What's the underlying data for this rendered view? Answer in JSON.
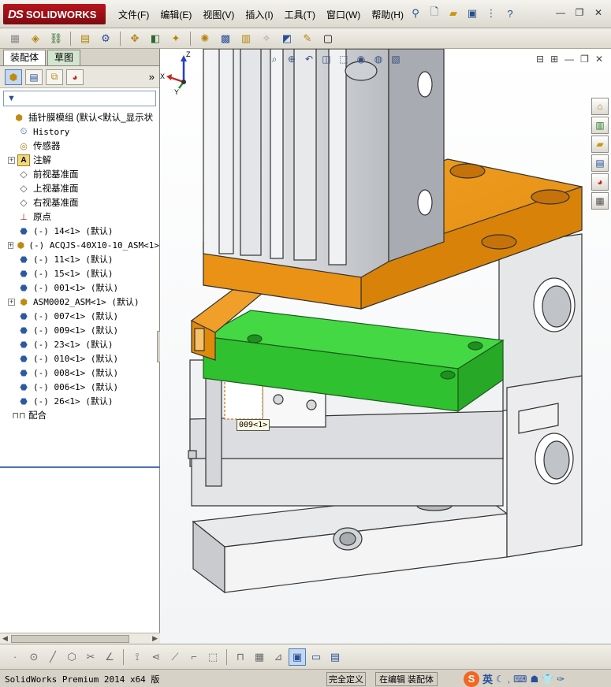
{
  "app": {
    "logo_ds": "DS",
    "logo_name": "SOLIDWORKS"
  },
  "menu": [
    "文件(F)",
    "编辑(E)",
    "视图(V)",
    "插入(I)",
    "工具(T)",
    "窗口(W)",
    "帮助(H)"
  ],
  "left_panel": {
    "tabs": [
      "装配体",
      "草图"
    ],
    "chevron": "»",
    "filter_icon": "filter-icon",
    "tree": [
      {
        "label": "插针膜模组   (默认<默认_显示状",
        "icon": "assembly-icon",
        "expand": "none",
        "indent": 0
      },
      {
        "label": "History",
        "icon": "history-icon",
        "expand": "none",
        "indent": 1
      },
      {
        "label": "传感器",
        "icon": "sensor-icon",
        "expand": "none",
        "indent": 1
      },
      {
        "label": "注解",
        "icon": "annotation-icon",
        "expand": "+",
        "indent": 1
      },
      {
        "label": "前视基准面",
        "icon": "plane-icon",
        "expand": "none",
        "indent": 1
      },
      {
        "label": "上视基准面",
        "icon": "plane-icon",
        "expand": "none",
        "indent": 1
      },
      {
        "label": "右视基准面",
        "icon": "plane-icon",
        "expand": "none",
        "indent": 1
      },
      {
        "label": "原点",
        "icon": "origin-icon",
        "expand": "none",
        "indent": 1
      },
      {
        "label": "(-) 14<1> (默认)",
        "icon": "part-icon",
        "expand": "none",
        "indent": 1
      },
      {
        "label": "(-) ACQJS-40X10-10_ASM<1>",
        "icon": "subassembly-icon",
        "expand": "+",
        "indent": 1
      },
      {
        "label": "(-) 11<1> (默认)",
        "icon": "part-icon",
        "expand": "none",
        "indent": 1
      },
      {
        "label": "(-) 15<1> (默认)",
        "icon": "part-icon",
        "expand": "none",
        "indent": 1
      },
      {
        "label": "(-) 001<1> (默认)",
        "icon": "part-icon",
        "expand": "none",
        "indent": 1
      },
      {
        "label": "ASM0002_ASM<1> (默认)",
        "icon": "subassembly-icon",
        "expand": "+",
        "indent": 1
      },
      {
        "label": "(-) 007<1> (默认)",
        "icon": "part-icon",
        "expand": "none",
        "indent": 1
      },
      {
        "label": "(-) 009<1> (默认)",
        "icon": "part-icon",
        "expand": "none",
        "indent": 1
      },
      {
        "label": "(-) 23<1> (默认)",
        "icon": "part-icon",
        "expand": "none",
        "indent": 1
      },
      {
        "label": "(-) 010<1> (默认)",
        "icon": "part-icon",
        "expand": "none",
        "indent": 1
      },
      {
        "label": "(-) 008<1> (默认)",
        "icon": "part-icon",
        "expand": "none",
        "indent": 1
      },
      {
        "label": "(-) 006<1> (默认)",
        "icon": "part-icon",
        "expand": "none",
        "indent": 1
      },
      {
        "label": "(-) 26<1> (默认)",
        "icon": "part-icon",
        "expand": "none",
        "indent": 1
      },
      {
        "label": "配合",
        "icon": "mates-icon",
        "expand": "none",
        "indent": 0
      }
    ]
  },
  "viewport": {
    "tooltip": "009<1>",
    "triad": {
      "x": "X",
      "y": "Y",
      "z": "Z"
    },
    "colors": {
      "highlight_green": "#33cc33",
      "orange_part": "#e8920f",
      "steel": "#cfd2d6"
    }
  },
  "statusbar": {
    "app": "SolidWorks Premium 2014 x64 版",
    "definition": "完全定义",
    "edit_mode": "在编辑 装配体",
    "ime_logo": "S",
    "ime_lang": "英"
  }
}
